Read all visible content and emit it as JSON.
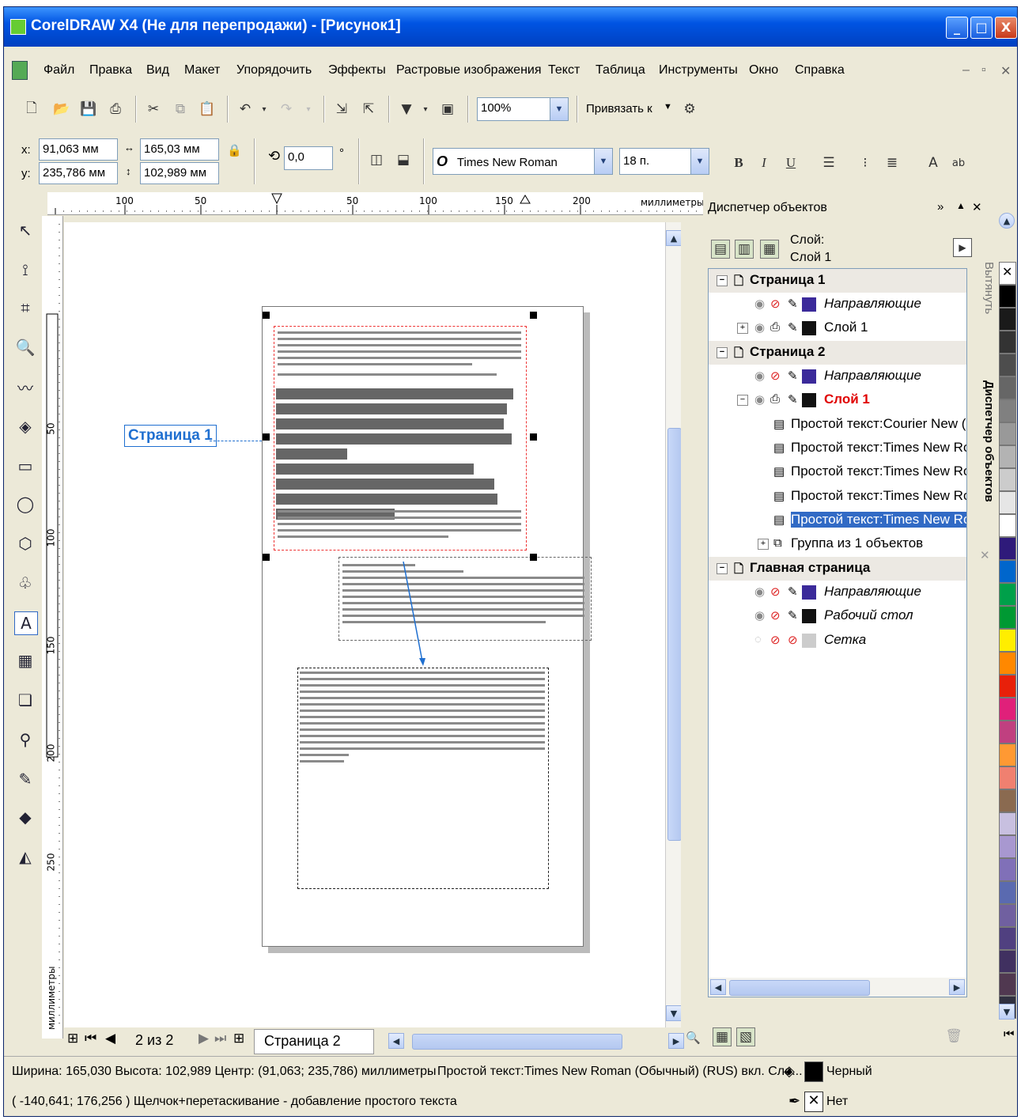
{
  "window": {
    "title": "CorelDRAW X4 (Не для перепродажи) - [Рисунок1]",
    "controls": [
      "_",
      "□",
      "X"
    ]
  },
  "menu": [
    "Файл",
    "Правка",
    "Вид",
    "Макет",
    "Упорядочить",
    "Эффекты",
    "Растровые изображения",
    "Текст",
    "Таблица",
    "Инструменты",
    "Окно",
    "Справка"
  ],
  "toolbar": {
    "zoom": "100%",
    "snap_label": "Привязать к"
  },
  "propbar": {
    "x_label": "x:",
    "x_value": "91,063 мм",
    "y_label": "y:",
    "y_value": "235,786 мм",
    "w_value": "165,03 мм",
    "h_value": "102,989 мм",
    "angle_value": "0,0",
    "angle_unit": "°",
    "font_name": "Times New Roman",
    "font_size": "18 п.",
    "font_glyph": "O"
  },
  "ruler": {
    "h_ticks": [
      "100",
      "50",
      "50",
      "100",
      "150",
      "200"
    ],
    "h_unit": "миллиметры",
    "v_ticks": [
      "50",
      "100",
      "150",
      "200",
      "250"
    ],
    "v_unit": "миллиметры"
  },
  "canvas": {
    "page_callout": "Страница 1"
  },
  "pagenav": {
    "counter": "2 из 2",
    "current_tab": "Страница 2"
  },
  "docker": {
    "title": "Диспетчер объектов",
    "layer_label": "Слой:",
    "layer_value": "Слой 1",
    "side_tab_1": "Вытянуть",
    "side_tab_2": "Диспетчер объектов",
    "tree": [
      {
        "label": "Страница 1",
        "kind": "page"
      },
      {
        "label": "Направляющие",
        "kind": "layer",
        "color": "#3b2a9a"
      },
      {
        "label": "Слой 1",
        "kind": "layer",
        "color": "#111111"
      },
      {
        "label": "Страница 2",
        "kind": "page"
      },
      {
        "label": "Направляющие",
        "kind": "layer",
        "color": "#3b2a9a"
      },
      {
        "label": "Слой 1",
        "kind": "layer-active",
        "color": "#111111"
      },
      {
        "label": "Простой текст:Courier New (Обы",
        "kind": "obj"
      },
      {
        "label": "Простой текст:Times New Roman",
        "kind": "obj"
      },
      {
        "label": "Простой текст:Times New Roman",
        "kind": "obj"
      },
      {
        "label": "Простой текст:Times New Roman",
        "kind": "obj"
      },
      {
        "label": "Простой текст:Times New Roman",
        "kind": "obj-selected"
      },
      {
        "label": "Группа из 1 объектов",
        "kind": "group"
      },
      {
        "label": "Главная страница",
        "kind": "page"
      },
      {
        "label": "Направляющие",
        "kind": "layer",
        "color": "#3b2a9a"
      },
      {
        "label": "Рабочий стол",
        "kind": "layer",
        "color": "#111111"
      },
      {
        "label": "Сетка",
        "kind": "layer",
        "color": "#cccccc"
      }
    ]
  },
  "status": {
    "line1": "Ширина: 165,030 Высота: 102,989 Центр: (91,063; 235,786) миллиметры",
    "line1_right": "Простой текст:Times New Roman (Обычный) (RUS) вкл. Сло...",
    "fill_name": "Черный",
    "line2": "( -140,641; 176,256 )  Щелчок+перетаскивание - добавление простого текста",
    "outline_name": "Нет"
  },
  "colors": {
    "titlebar": "#0054e3",
    "selection": "#316ac5",
    "active_layer": "#e00000",
    "frame_red": "#ee3333"
  },
  "palette": [
    "#ffffff",
    "#000000",
    "#1a1a1a",
    "#333333",
    "#4d4d4d",
    "#666666",
    "#808080",
    "#999999",
    "#b3b3b3",
    "#cccccc",
    "#e6e6e6",
    "#ffffff",
    "#2e1a7a",
    "#0066cc",
    "#00a04a",
    "#009933",
    "#ffee00",
    "#ff8800",
    "#e8200a",
    "#e0207a",
    "#c04080",
    "#ff9933",
    "#f08070",
    "#8a6a50",
    "#c8c0e0",
    "#a898d0",
    "#8070b8",
    "#5a6ab0",
    "#7060a0",
    "#504080",
    "#403060",
    "#503850",
    "#303040"
  ]
}
